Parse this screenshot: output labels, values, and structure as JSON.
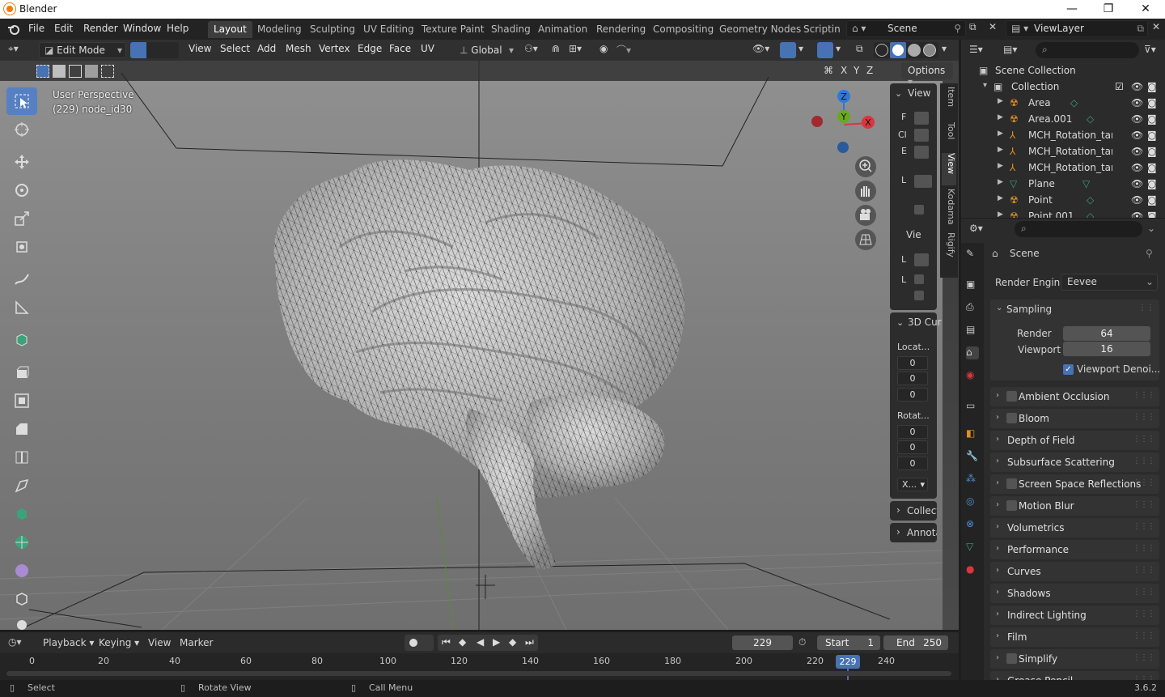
{
  "window": {
    "title": "Blender",
    "controls": [
      "—",
      "❐",
      "✕"
    ]
  },
  "menu": [
    "File",
    "Edit",
    "Render",
    "Window",
    "Help"
  ],
  "workspaces": [
    "Layout",
    "Modeling",
    "Sculpting",
    "UV Editing",
    "Texture Paint",
    "Shading",
    "Animation",
    "Rendering",
    "Compositing",
    "Geometry Nodes",
    "Scripting"
  ],
  "active_workspace": "Layout",
  "scene_field": "Scene",
  "viewlayer_field": "ViewLayer",
  "header": {
    "mode": "Edit Mode",
    "items": [
      "View",
      "Select",
      "Add",
      "Mesh",
      "Vertex",
      "Edge",
      "Face",
      "UV"
    ],
    "transform_orientation": "Global",
    "options": "Options"
  },
  "viewport": {
    "perspective": "User Perspective",
    "object_info": "(229) node_id30",
    "gizmo_axes": {
      "z": "Z",
      "y": "Y",
      "x": "X"
    },
    "axis_toggles": [
      "X",
      "Y",
      "Z"
    ]
  },
  "npanel": {
    "tabs": [
      "Item",
      "Tool",
      "View",
      "Kodama",
      "Rigify"
    ],
    "active_tab": "View",
    "view_section": "View",
    "view_rows": [
      "F",
      "Cl",
      "E",
      "L"
    ],
    "vie_section": "Vie",
    "vie_rows": [
      "L",
      "L"
    ],
    "cursor_section": "3D Cur",
    "location_label": "Locat...",
    "location": [
      "0",
      "0",
      "0"
    ],
    "rotation_label": "Rotat...",
    "rotation": [
      "0",
      "0",
      "0"
    ],
    "rotation_mode": "X...",
    "collect_section": "Collect",
    "annota_section": "Annota"
  },
  "outliner": {
    "search_placeholder": "",
    "root": "Scene Collection",
    "collection": "Collection",
    "items": [
      {
        "name": "Area",
        "type": "light"
      },
      {
        "name": "Area.001",
        "type": "light"
      },
      {
        "name": "MCH_Rotation_targ",
        "type": "armature"
      },
      {
        "name": "MCH_Rotation_targ",
        "type": "armature"
      },
      {
        "name": "MCH_Rotation_targ",
        "type": "armature"
      },
      {
        "name": "Plane",
        "type": "mesh"
      },
      {
        "name": "Point",
        "type": "light"
      },
      {
        "name": "Point.001",
        "type": "light"
      }
    ]
  },
  "properties": {
    "context": "Scene",
    "render_engine_label": "Render Engine",
    "render_engine": "Eevee",
    "sampling": {
      "title": "Sampling",
      "render_label": "Render",
      "render": "64",
      "viewport_label": "Viewport",
      "viewport": "16",
      "denoise_label": "Viewport Denoi..."
    },
    "sections": [
      {
        "name": "Ambient Occlusion",
        "checkbox": true
      },
      {
        "name": "Bloom",
        "checkbox": true
      },
      {
        "name": "Depth of Field",
        "checkbox": false
      },
      {
        "name": "Subsurface Scattering",
        "checkbox": false
      },
      {
        "name": "Screen Space Reflections",
        "checkbox": true
      },
      {
        "name": "Motion Blur",
        "checkbox": true
      },
      {
        "name": "Volumetrics",
        "checkbox": false
      },
      {
        "name": "Performance",
        "checkbox": false
      },
      {
        "name": "Curves",
        "checkbox": false
      },
      {
        "name": "Shadows",
        "checkbox": false
      },
      {
        "name": "Indirect Lighting",
        "checkbox": false
      },
      {
        "name": "Film",
        "checkbox": false
      },
      {
        "name": "Simplify",
        "checkbox": true
      },
      {
        "name": "Grease Pencil",
        "checkbox": false
      }
    ]
  },
  "timeline": {
    "menus": [
      "Playback",
      "Keying",
      "View",
      "Marker"
    ],
    "current_frame": "229",
    "start_label": "Start",
    "start": "1",
    "end_label": "End",
    "end": "250",
    "ticks": [
      "0",
      "20",
      "40",
      "60",
      "80",
      "100",
      "120",
      "140",
      "160",
      "180",
      "200",
      "220",
      "240"
    ],
    "playhead": "229"
  },
  "status": {
    "select": "Select",
    "rotate": "Rotate View",
    "call_menu": "Call Menu",
    "version": "3.6.2"
  },
  "colors": {
    "accent": "#5680c2",
    "active_frame": "#4772b3",
    "x_axis": "#d9363e",
    "y_axis": "#6aa820",
    "z_axis": "#2f78d8"
  }
}
